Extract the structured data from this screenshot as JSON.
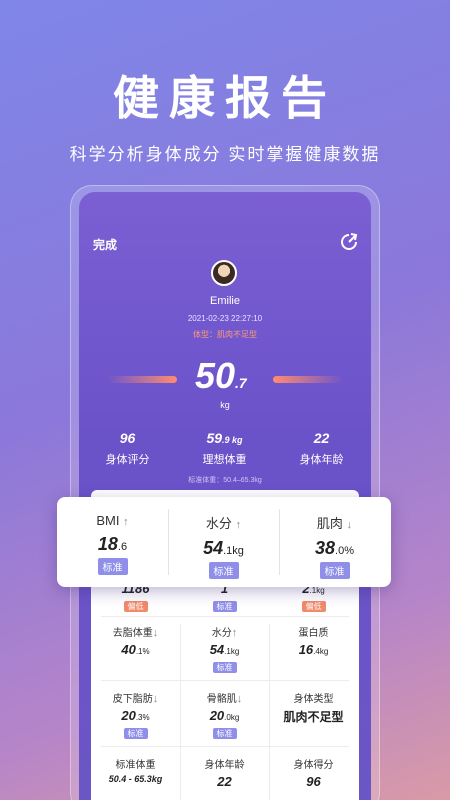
{
  "hero": {
    "title": "健康报告",
    "subtitle": "科学分析身体成分  实时掌握健康数据"
  },
  "header": {
    "done_label": "完成",
    "share_icon": "share-icon"
  },
  "profile": {
    "name": "Emilie",
    "datetime": "2021-02-23 22:27:10",
    "body_type_line": "体型：肌肉不足型"
  },
  "weight": {
    "int_part": "50",
    "dec_part": ".7",
    "unit": "kg"
  },
  "summary": [
    {
      "value": "96",
      "unit": "",
      "label": "身体评分"
    },
    {
      "value": "59",
      "unit": ".9 kg",
      "label": "理想体重"
    },
    {
      "value": "22",
      "unit": "",
      "label": "身体年龄"
    }
  ],
  "standard_weight_line": "标准体重：50.4–65.3kg",
  "popup": [
    {
      "label": "BMI",
      "arrow": "↑",
      "value": "18",
      "dec": ".6",
      "unit": "",
      "tag": "标准"
    },
    {
      "label": "水分",
      "arrow": "↑",
      "value": "54",
      "dec": ".1",
      "unit": "kg",
      "tag": "标准"
    },
    {
      "label": "肌肉",
      "arrow": "↓",
      "value": "38",
      "dec": ".0",
      "unit": "%",
      "tag": "标准"
    }
  ],
  "grid_row0": [
    {
      "value": "1186",
      "tag": "偏低",
      "tag_type": "warn"
    },
    {
      "value": "1",
      "tag": "标准",
      "tag_type": "normal"
    },
    {
      "value": "2",
      "dec": ".1",
      "unit": "kg",
      "tag": "偏低",
      "tag_type": "warn"
    }
  ],
  "grid_row1": [
    {
      "label": "去脂体重",
      "arrow": "↓",
      "value": "40",
      "dec": ".1",
      "unit": "%"
    },
    {
      "label": "水分",
      "arrow": "↑",
      "value": "54",
      "dec": ".1",
      "unit": "kg",
      "tag": "标准"
    },
    {
      "label": "蛋白质",
      "arrow": "",
      "value": "16",
      "dec": ".4",
      "unit": "kg"
    }
  ],
  "grid_row2": [
    {
      "label": "皮下脂肪",
      "arrow": "↓",
      "value": "20",
      "dec": ".3",
      "unit": "%",
      "tag": "标准"
    },
    {
      "label": "骨骼肌",
      "arrow": "↓",
      "value": "20",
      "dec": ".0",
      "unit": "kg",
      "tag": "标准"
    },
    {
      "label": "身体类型",
      "arrow": "",
      "value": "肌肉不足型"
    }
  ],
  "grid_row3": [
    {
      "label": "标准体重",
      "value": "50.4 - 65.3kg"
    },
    {
      "label": "身体年龄",
      "value": "22"
    },
    {
      "label": "身体得分",
      "value": "96"
    }
  ],
  "colors": {
    "accent": "#8f8ee8",
    "warn": "#f08a6a",
    "orange_bar": "#ff8c6e"
  }
}
